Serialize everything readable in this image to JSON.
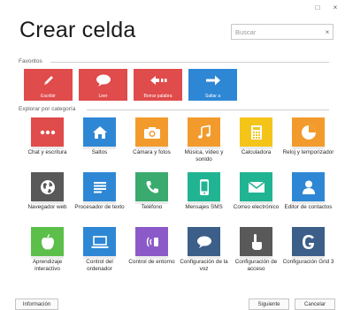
{
  "window": {
    "maximize": "□",
    "close": "×"
  },
  "title": "Crear celda",
  "search": {
    "placeholder": "Buscar",
    "clear": "×"
  },
  "favorites": {
    "label": "Favoritos",
    "items": [
      {
        "label": "Escribir",
        "icon": "pencil-icon",
        "color": "#e04b4b"
      },
      {
        "label": "Leer",
        "icon": "speech-bubble-icon",
        "color": "#e04b4b"
      },
      {
        "label": "Borrar palabra",
        "icon": "backspace-icon",
        "color": "#e04b4b"
      },
      {
        "label": "Saltar a",
        "icon": "arrow-right-icon",
        "color": "#2e87d4"
      }
    ]
  },
  "categories": {
    "label": "Explorar por categoría",
    "items": [
      {
        "label": "Chat y escritura",
        "icon": "chat-icon",
        "color": "#e04b4b"
      },
      {
        "label": "Saltos",
        "icon": "home-icon",
        "color": "#2e87d4"
      },
      {
        "label": "Cámara y fotos",
        "icon": "camera-icon",
        "color": "#f29b2c"
      },
      {
        "label": "Música, vídeo y sonido",
        "icon": "music-icon",
        "color": "#f29b2c"
      },
      {
        "label": "Calculadora",
        "icon": "calculator-icon",
        "color": "#f5c419"
      },
      {
        "label": "Reloj y temporizador",
        "icon": "clock-icon",
        "color": "#f29b2c"
      },
      {
        "label": "Navegador web",
        "icon": "globe-icon",
        "color": "#595959"
      },
      {
        "label": "Procesador de texto",
        "icon": "document-icon",
        "color": "#2e87d4"
      },
      {
        "label": "Teléfono",
        "icon": "phone-icon",
        "color": "#3aaa6e"
      },
      {
        "label": "Mensajes SMS",
        "icon": "mobile-icon",
        "color": "#21b493"
      },
      {
        "label": "Correo electrónico",
        "icon": "mail-icon",
        "color": "#21b493"
      },
      {
        "label": "Editor de contactos",
        "icon": "contact-icon",
        "color": "#2e87d4"
      },
      {
        "label": "Aprendizaje interactivo",
        "icon": "apple-icon",
        "color": "#5bbf4a"
      },
      {
        "label": "Control del ordenador",
        "icon": "laptop-icon",
        "color": "#2e87d4"
      },
      {
        "label": "Control de entorno",
        "icon": "remote-icon",
        "color": "#8c5ac8"
      },
      {
        "label": "Configuración de la voz",
        "icon": "speech-settings-icon",
        "color": "#3b5f88"
      },
      {
        "label": "Configuración de acceso",
        "icon": "touch-icon",
        "color": "#595959"
      },
      {
        "label": "Configuración Grid 3",
        "icon": "grid3-logo-icon",
        "color": "#3b5f88"
      }
    ]
  },
  "footer": {
    "info": "Información",
    "next": "Siguiente",
    "cancel": "Cancelar"
  }
}
